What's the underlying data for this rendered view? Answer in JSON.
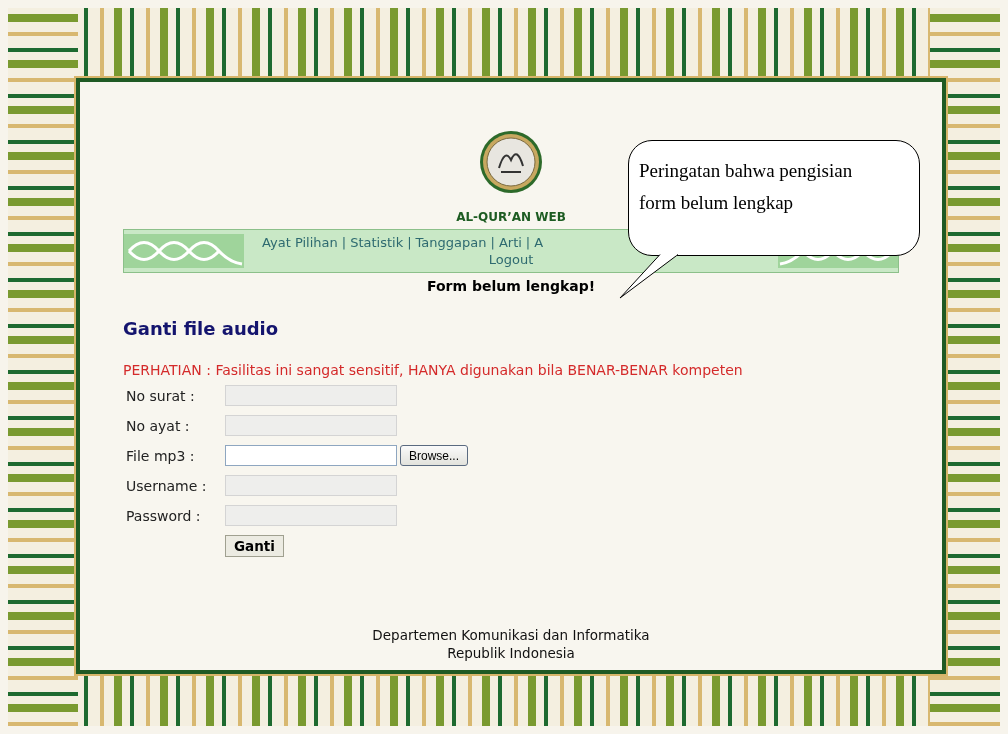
{
  "logo": {
    "title": "AL-QUR’AN WEB"
  },
  "nav": {
    "items": [
      "Ayat Pilihan",
      "Statistik",
      "Tanggapan",
      "Arti",
      "A"
    ],
    "separator": "|",
    "second_line": "Logout"
  },
  "alert": "Form belum lengkap!",
  "heading": "Ganti file audio",
  "warning": "PERHATIAN : Fasilitas ini sangat sensitif, HANYA digunakan bila BENAR-BENAR kompeten",
  "form": {
    "fields": [
      {
        "label": "No surat :",
        "kind": "text"
      },
      {
        "label": "No ayat :",
        "kind": "text"
      },
      {
        "label": "File mp3 :",
        "kind": "file",
        "button": "Browse..."
      },
      {
        "label": "Username :",
        "kind": "text"
      },
      {
        "label": "Password :",
        "kind": "password"
      }
    ],
    "submit": "Ganti"
  },
  "footer": [
    "Departemen Komunikasi dan Informatika",
    "Republik Indonesia"
  ],
  "callout": {
    "text": "Peringatan bahwa pengisian form belum lengkap"
  }
}
